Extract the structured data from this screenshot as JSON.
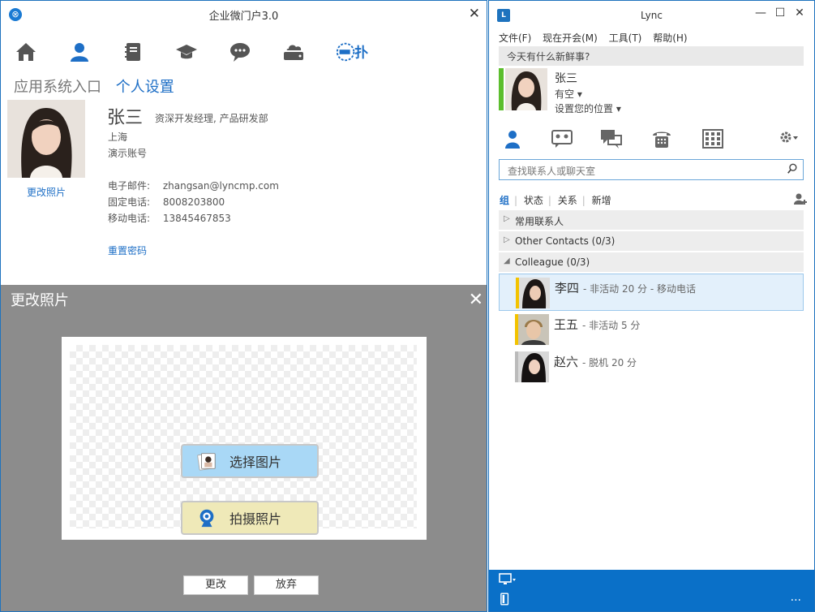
{
  "portal": {
    "title": "企业微门户3.0",
    "logo_letter": "⊗",
    "close": "✕",
    "nav_icons": [
      "home-icon",
      "person-icon",
      "notebook-icon",
      "graduation-cap-icon",
      "chat-bubble-icon",
      "cloud-drive-icon",
      "brand-logo-icon"
    ],
    "brand_text": "扑",
    "tabs": [
      "应用系统入口",
      "个人设置"
    ],
    "profile": {
      "name": "张三",
      "title": "资深开发经理, 产品研发部",
      "city": "上海",
      "account": "演示账号",
      "change_photo": "更改照片",
      "fields": [
        {
          "label": "电子邮件:",
          "value": "zhangsan@lyncmp.com"
        },
        {
          "label": "固定电话:",
          "value": "8008203800"
        },
        {
          "label": "移动电话:",
          "value": "13845467853"
        }
      ],
      "reset_password": "重置密码"
    },
    "dialog": {
      "title": "更改照片",
      "close": "✕",
      "select_label": "选择图片",
      "shoot_label": "拍摄照片",
      "ok_label": "更改",
      "cancel_label": "放弃"
    }
  },
  "lync": {
    "title": "Lync",
    "logo": "L",
    "controls": [
      "—",
      "☐",
      "✕"
    ],
    "menu": [
      "文件(F)",
      "现在开会(M)",
      "工具(T)",
      "帮助(H)"
    ],
    "whats_new": "今天有什么新鲜事?",
    "self": {
      "name": "张三",
      "status": "有空 ▾",
      "location": "设置您的位置 ▾",
      "status_color": "#5cbe2d"
    },
    "search_placeholder": "查找联系人或聊天室",
    "filters": [
      "组",
      "状态",
      "关系",
      "新增"
    ],
    "groups": [
      {
        "arrow": "▷",
        "label": "常用联系人"
      },
      {
        "arrow": "▷",
        "label": "Other Contacts (0/3)"
      },
      {
        "arrow": "◢",
        "label": "Colleague (0/3)"
      }
    ],
    "contacts": [
      {
        "name": "李四",
        "status": "- 非活动 20 分 - 移动电话",
        "presence": "#f3c300"
      },
      {
        "name": "王五",
        "status": "- 非活动 5 分",
        "presence": "#f3c300"
      },
      {
        "name": "赵六",
        "status": "- 脱机 20 分",
        "presence": "#bbbbbb"
      }
    ],
    "bottom_more": "..."
  }
}
